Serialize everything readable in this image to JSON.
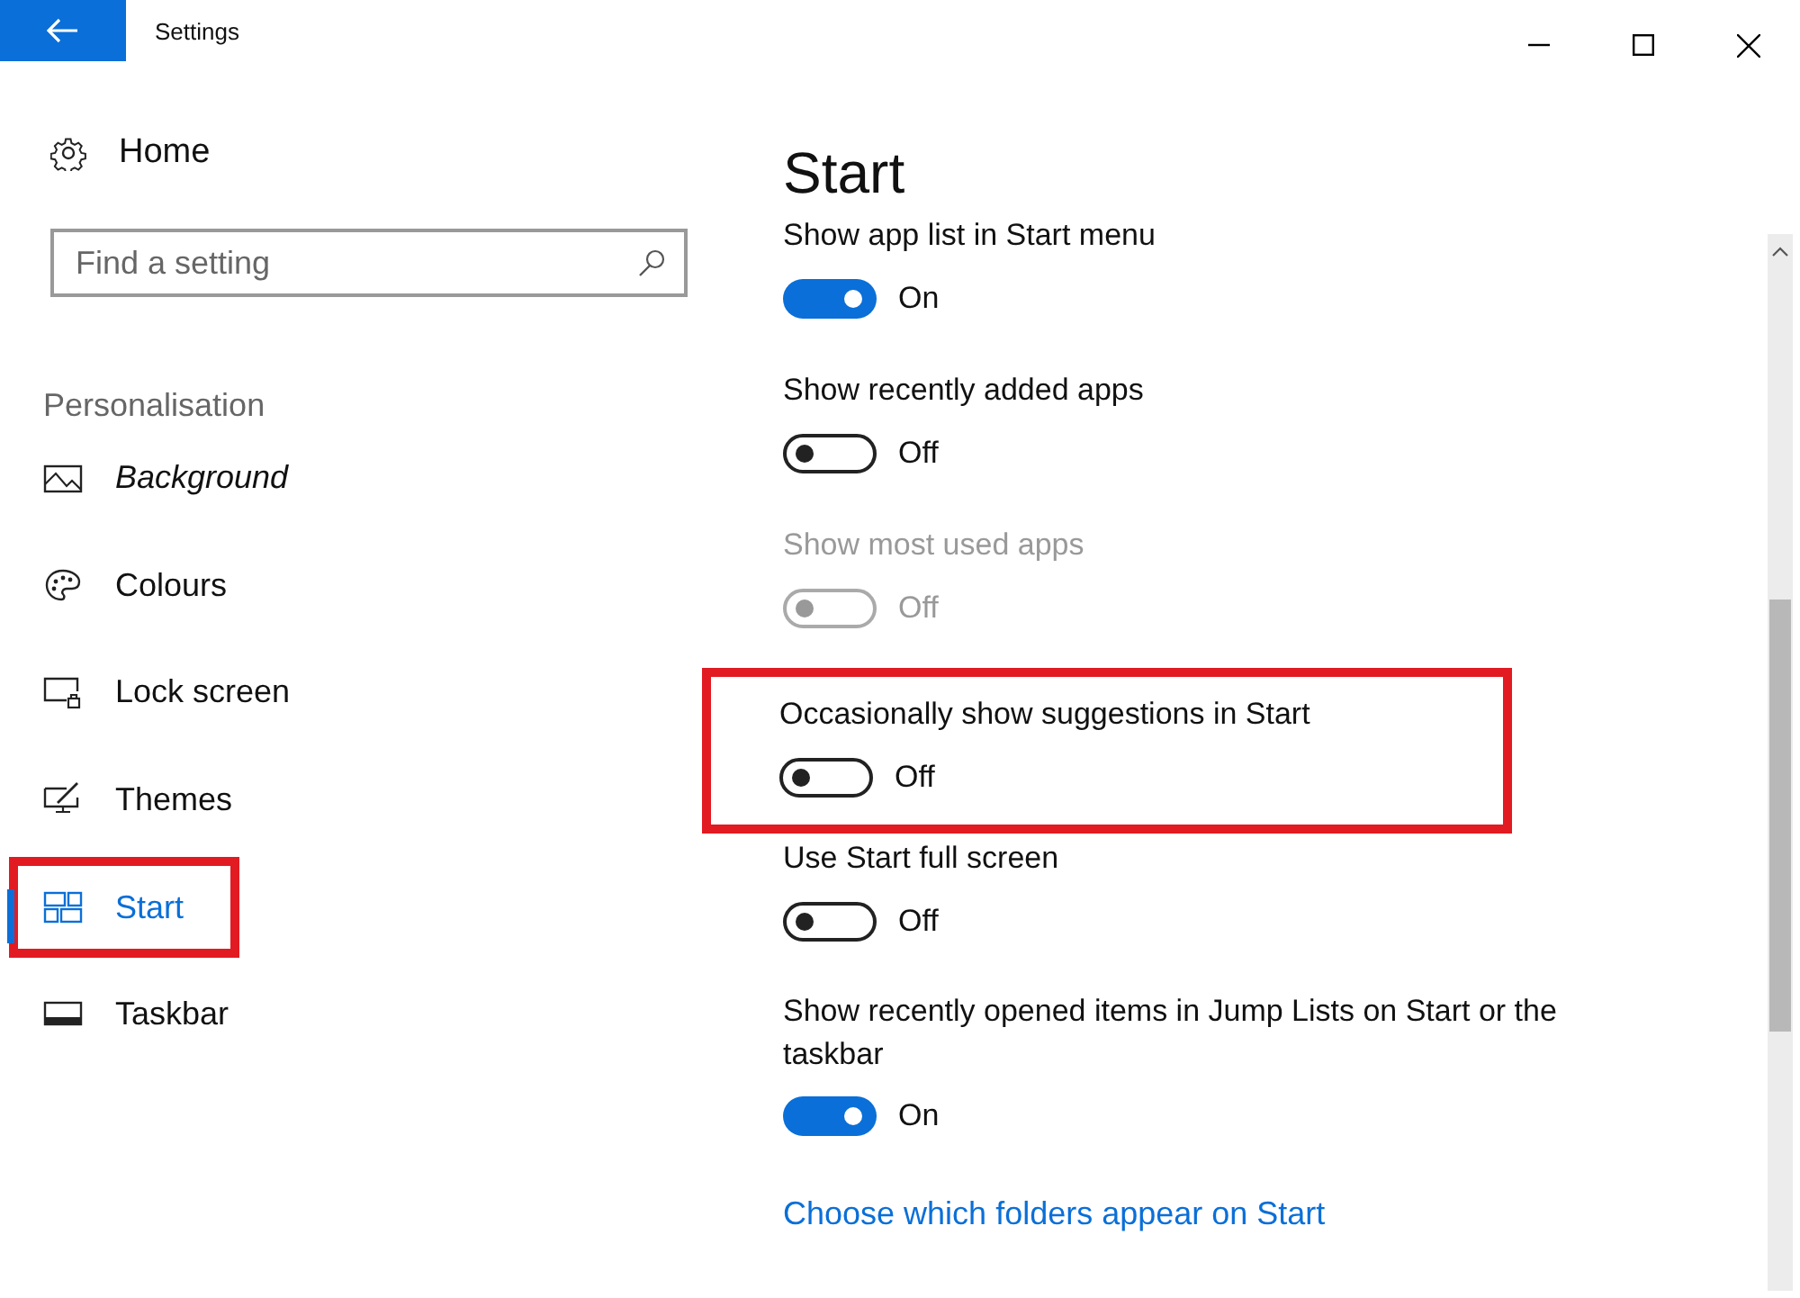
{
  "window": {
    "title": "Settings"
  },
  "sidebar": {
    "home": "Home",
    "search": {
      "placeholder": "Find a setting"
    },
    "section": "Personalisation",
    "items": [
      {
        "label": "Background",
        "selected": false,
        "highlighted": false
      },
      {
        "label": "Colours",
        "selected": false,
        "highlighted": false
      },
      {
        "label": "Lock screen",
        "selected": false,
        "highlighted": false
      },
      {
        "label": "Themes",
        "selected": false,
        "highlighted": false
      },
      {
        "label": "Start",
        "selected": true,
        "highlighted": true
      },
      {
        "label": "Taskbar",
        "selected": false,
        "highlighted": false
      }
    ]
  },
  "page": {
    "title": "Start",
    "settings": [
      {
        "label": "Show app list in Start menu",
        "on": true,
        "state_text": "On",
        "disabled": false,
        "highlighted": false
      },
      {
        "label": "Show recently added apps",
        "on": false,
        "state_text": "Off",
        "disabled": false,
        "highlighted": false
      },
      {
        "label": "Show most used apps",
        "on": false,
        "state_text": "Off",
        "disabled": true,
        "highlighted": false
      },
      {
        "label": "Occasionally show suggestions in Start",
        "on": false,
        "state_text": "Off",
        "disabled": false,
        "highlighted": true
      },
      {
        "label": "Use Start full screen",
        "on": false,
        "state_text": "Off",
        "disabled": false,
        "highlighted": false
      },
      {
        "label": "Show recently opened items in Jump Lists on Start or the taskbar",
        "on": true,
        "state_text": "On",
        "disabled": false,
        "highlighted": false
      }
    ],
    "link": "Choose which folders appear on Start"
  }
}
